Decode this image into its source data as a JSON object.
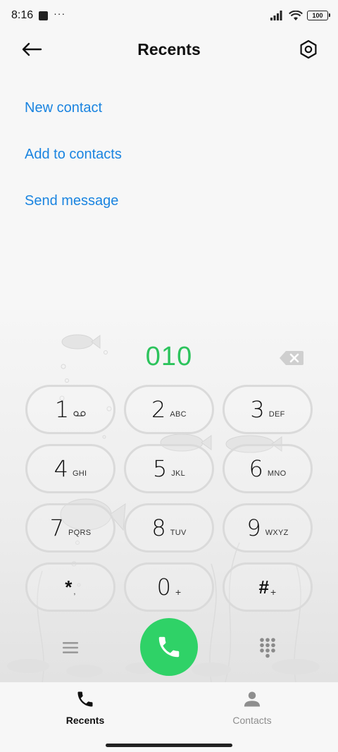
{
  "status_bar": {
    "time": "8:16",
    "dots": "···",
    "battery": "100",
    "icons": [
      "app-square-icon",
      "signal-icon",
      "wifi-icon",
      "battery-icon"
    ]
  },
  "header": {
    "title": "Recents",
    "back_icon": "back-arrow-icon",
    "settings_icon": "settings-hexagon-icon"
  },
  "actions": [
    {
      "label": "New contact"
    },
    {
      "label": "Add to contacts"
    },
    {
      "label": "Send message"
    }
  ],
  "dialer": {
    "number": "010",
    "keys": [
      {
        "digit": "1",
        "letters": "",
        "icon": "voicemail-icon"
      },
      {
        "digit": "2",
        "letters": "ABC"
      },
      {
        "digit": "3",
        "letters": "DEF"
      },
      {
        "digit": "4",
        "letters": "GHI"
      },
      {
        "digit": "5",
        "letters": "JKL"
      },
      {
        "digit": "6",
        "letters": "MNO"
      },
      {
        "digit": "7",
        "letters": "PQRS"
      },
      {
        "digit": "8",
        "letters": "TUV"
      },
      {
        "digit": "9",
        "letters": "WXYZ"
      },
      {
        "digit": "*",
        "letters": ","
      },
      {
        "digit": "0",
        "letters": "+"
      },
      {
        "digit": "#",
        "letters": "+"
      }
    ]
  },
  "bottom_nav": {
    "items": [
      {
        "label": "Recents",
        "icon": "phone-icon",
        "active": true
      },
      {
        "label": "Contacts",
        "icon": "person-icon",
        "active": false
      }
    ]
  },
  "colors": {
    "accent_blue": "#1a84e0",
    "call_green": "#2fd267",
    "number_green": "#2cc35c"
  }
}
